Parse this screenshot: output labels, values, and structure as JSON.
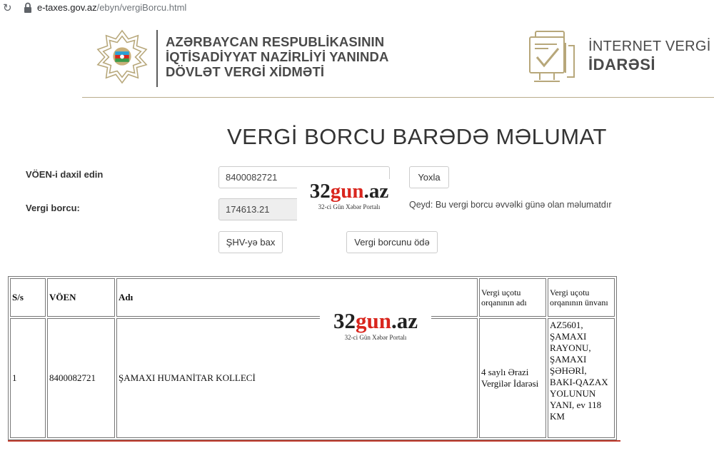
{
  "browser": {
    "url_host": "e-taxes.gov.az",
    "url_path": "/ebyn/vergiBorcu.html"
  },
  "header": {
    "agency_line1": "AZƏRBAYCAN RESPUBLİKASININ",
    "agency_line2": "İQTİSADİYYAT NAZİRLİYİ YANINDA",
    "agency_line3": "DÖVLƏT VERGİ XİDMƏTİ",
    "ivd_line1": "İNTERNET VERGİ",
    "ivd_line2": "İDARƏSİ"
  },
  "page_title": "VERGİ BORCU BARƏDƏ MƏLUMAT",
  "form": {
    "voen_label": "VÖEN-i daxil edin",
    "voen_value": "8400082721",
    "check_button": "Yoxla",
    "debt_label": "Vergi borcu:",
    "debt_value": "174613.21",
    "note": "Qeyd: Bu vergi borcu əvvəlki günə olan məlumatdır",
    "shv_button": "ŞHV-yə bax",
    "pay_button": "Vergi borcunu ödə"
  },
  "watermark": {
    "brand_black": "32",
    "brand_red": "gun",
    "brand_suffix": ".az",
    "subtitle": "32-ci Gün Xəbər Portalı"
  },
  "table": {
    "headers": [
      "S/s",
      "VÖEN",
      "Adı",
      "Vergi uçotu orqanının adı",
      "Vergi uçotu orqanının ünvanı"
    ],
    "rows": [
      {
        "ss": "1",
        "voen": "8400082721",
        "name": "ŞAMAXI HUMANİTAR KOLLECİ",
        "org_name": "4 saylı Ərazi Vergilər İdarəsi",
        "org_address": "AZ5601, ŞAMAXI RAYONU, ŞAMAXI ŞƏHƏRİ, BAKI-QAZAX YOLUNUN YANI, ev 118 KM"
      }
    ]
  },
  "colors": {
    "accent_red": "#d9251d",
    "header_line": "#b9ad8d",
    "footer_line": "#c0392b"
  },
  "icons": [
    "reload-icon",
    "lock-icon",
    "emblem-icon",
    "internet-tax-icon"
  ]
}
